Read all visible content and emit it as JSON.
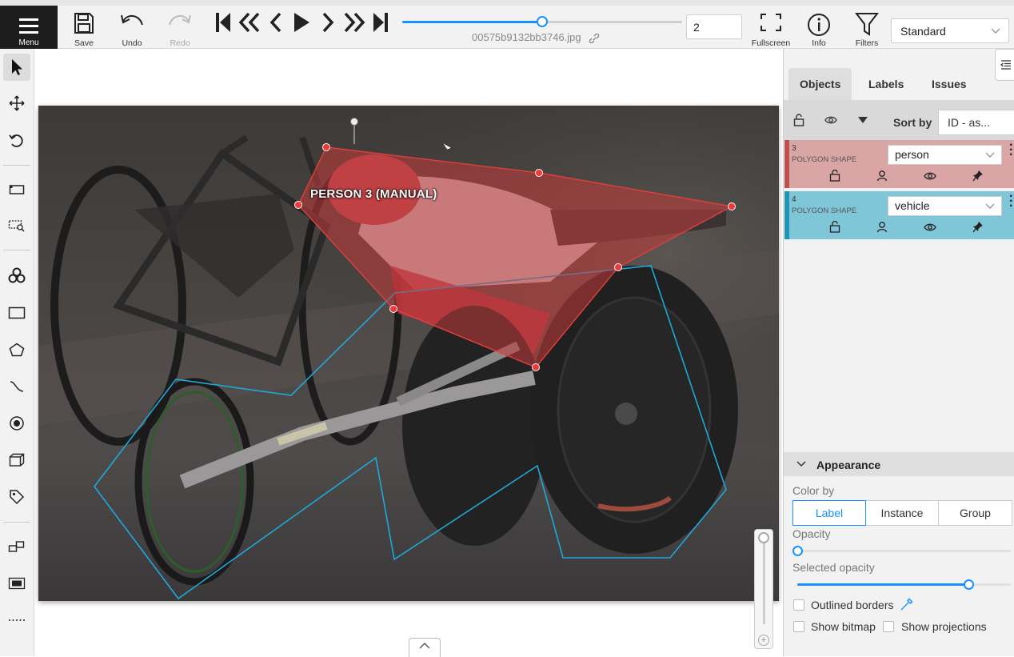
{
  "topbar": {
    "menu_label": "Menu",
    "save_label": "Save",
    "undo_label": "Undo",
    "redo_label": "Redo",
    "fullscreen_label": "Fullscreen",
    "info_label": "Info",
    "filters_label": "Filters",
    "frame_number": "2",
    "filename": "00575b9132bb3746.jpg",
    "frame_progress": 0.5,
    "workspace": "Standard"
  },
  "left_tools": [
    "cursor-icon",
    "move-icon",
    "rotate-icon",
    "fit-image-icon",
    "zoom-region-icon",
    "ai-tools-icon",
    "rectangle-icon",
    "polygon-icon",
    "polyline-icon",
    "points-icon",
    "cuboid-icon",
    "tag-icon",
    "merge-icon",
    "group-icon",
    "more-icon"
  ],
  "canvas": {
    "shape_label": "PERSON 3 (MANUAL)",
    "person_color": "#e0403b",
    "vehicle_color": "#1fa8d8"
  },
  "right_panel": {
    "tabs": [
      "Objects",
      "Labels",
      "Issues"
    ],
    "active_tab": "Objects",
    "sort_label": "Sort by",
    "sort_value": "ID - as...",
    "objects": [
      {
        "id": "3",
        "type": "POLYGON SHAPE",
        "label": "person",
        "color": "#d9a5a5",
        "stripe": "#c0504d"
      },
      {
        "id": "4",
        "type": "POLYGON SHAPE",
        "label": "vehicle",
        "color": "#7ec6d8",
        "stripe": "#1f95b8"
      }
    ],
    "appearance": {
      "title": "Appearance",
      "color_by_label": "Color by",
      "color_by_options": [
        "Label",
        "Instance",
        "Group"
      ],
      "color_by_selected": "Label",
      "opacity_label": "Opacity",
      "opacity_value": 0.0,
      "selected_opacity_label": "Selected opacity",
      "selected_opacity_value": 0.8,
      "outlined_borders_label": "Outlined borders",
      "show_bitmap_label": "Show bitmap",
      "show_projections_label": "Show projections"
    }
  }
}
